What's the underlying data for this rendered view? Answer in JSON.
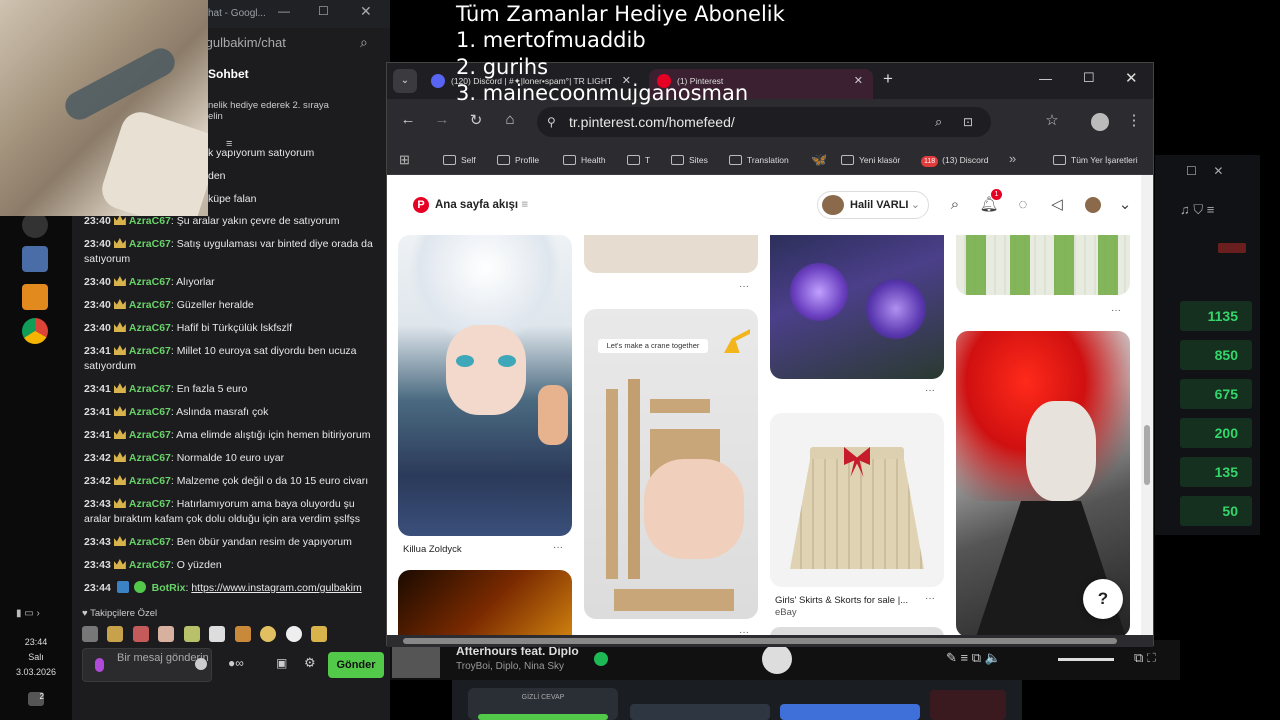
{
  "overlay": {
    "title": "Tüm Zamanlar Hediye  Abonelik",
    "line1": "1. mertofmuaddib",
    "line2": "2. gurihs",
    "line3": "3. mainecoonmujganosman"
  },
  "taskbar": {
    "time": "23:44",
    "day": "Salı",
    "date": "3.03.2026",
    "notif_count": "2"
  },
  "chat_window": {
    "title": "hat - Googl...",
    "url": "/gulbakim/chat",
    "header": "Sohbet",
    "pinned_line1": "nelik hediye ederek 2. sıraya",
    "pinned_line2": "elin",
    "partial1": "k yapıyorum satıyorum",
    "partial2": "den",
    "partial3": "küpe falan",
    "messages": [
      {
        "time": "23:40",
        "user": "AzraC67",
        "text": ": Şu aralar yakın çevre de satıyorum"
      },
      {
        "time": "23:40",
        "user": "AzraC67",
        "text": ": Satış uygulaması var binted diye orada da satıyorum"
      },
      {
        "time": "23:40",
        "user": "AzraC67",
        "text": ": Alıyorlar"
      },
      {
        "time": "23:40",
        "user": "AzraC67",
        "text": ": Güzeller heralde"
      },
      {
        "time": "23:40",
        "user": "AzraC67",
        "text": ": Hafif bi Türkçülük lskfszlf"
      },
      {
        "time": "23:41",
        "user": "AzraC67",
        "text": ": Millet 10 euroya sat diyordu ben ucuza satıyordum"
      },
      {
        "time": "23:41",
        "user": "AzraC67",
        "text": ": En fazla 5 euro"
      },
      {
        "time": "23:41",
        "user": "AzraC67",
        "text": ": Aslında masrafı çok"
      },
      {
        "time": "23:41",
        "user": "AzraC67",
        "text": ": Ama elimde alıştığı için hemen bitiriyorum"
      },
      {
        "time": "23:42",
        "user": "AzraC67",
        "text": ": Normalde 10 euro uyar"
      },
      {
        "time": "23:42",
        "user": "AzraC67",
        "text": ": Malzeme çok değil o da 10 15 euro civarı"
      },
      {
        "time": "23:43",
        "user": "AzraC67",
        "text": ": Hatırlamıyorum ama baya oluyordu şu aralar bıraktım kafam çok dolu olduğu için ara verdim şslfşs"
      },
      {
        "time": "23:43",
        "user": "AzraC67",
        "text": ": Ben öbür yandan resim de yapıyorum"
      },
      {
        "time": "23:43",
        "user": "AzraC67",
        "text": ": O yüzden"
      }
    ],
    "bot_message": {
      "time": "23:44",
      "user": "BotRix",
      "link": "https://www.instagram.com/gulbakim"
    },
    "emote_label": "Takipçilere Özel",
    "input_placeholder": "Bir mesaj gönderin",
    "send_label": "Gönder"
  },
  "chrome": {
    "tabs": [
      {
        "label": "(120) Discord | #✦|loner•spam°| TR LIGHT",
        "badge": "120"
      },
      {
        "label": "(1) Pinterest"
      }
    ],
    "url": "tr.pinterest.com/homefeed/",
    "bookmarks": [
      "Self",
      "Profile",
      "Health",
      "T",
      "Sites",
      "Translation",
      "Yeni klasör",
      "(13) Discord",
      "Tüm Yer İşaretleri"
    ],
    "discord_badge": "118"
  },
  "pinterest": {
    "feed_title": "Ana sayfa akışı",
    "user_name": "Halil VARLI",
    "notif_badge": "1",
    "pins": [
      {
        "caption": "Killua Zoldyck"
      },
      {
        "caption": "Let's make a crane together"
      },
      {
        "caption": "Girls' Skirts & Skorts for sale |...",
        "source": "eBay"
      }
    ],
    "help": "?"
  },
  "player": {
    "song": "Afterhours feat. Diplo",
    "artists": "TroyBoi, Diplo, Nina Sky"
  },
  "scores": [
    "1135",
    "850",
    "675",
    "200",
    "135",
    "50"
  ],
  "bottom_label": "GİZLİ CEVAP",
  "colors": {
    "accent_green": "#53c94a",
    "pinterest_red": "#e60023",
    "score_green": "#34d66b"
  }
}
